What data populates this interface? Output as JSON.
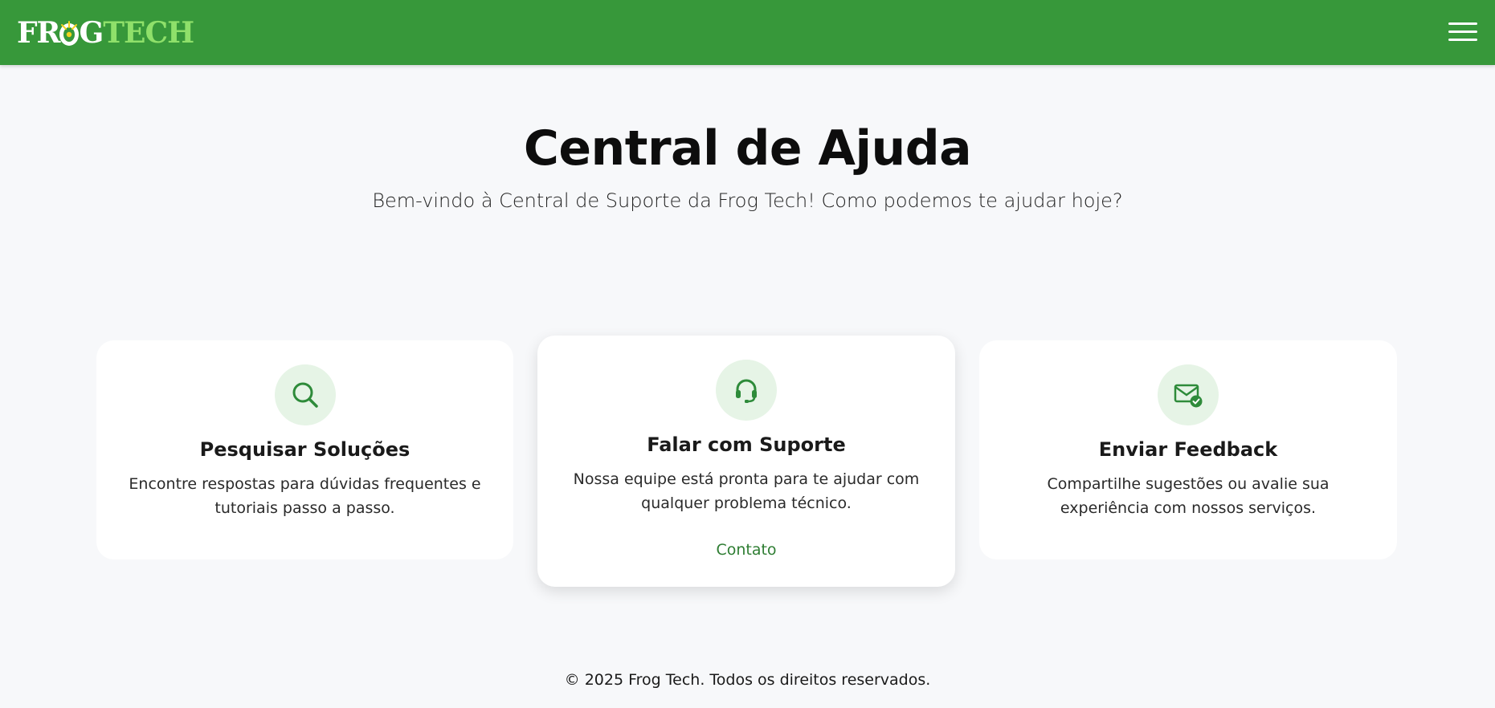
{
  "header": {
    "logo_part1": "FR",
    "logo_part2": "G",
    "logo_part3": "TECH",
    "brand_color": "#37983a",
    "logo_accent": "#8fe06a",
    "menu_icon": "hamburger-menu-icon"
  },
  "hero": {
    "title": "Central de Ajuda",
    "subtitle": "Bem-vindo à Central de Suporte da Frog Tech! Como podemos te ajudar hoje?"
  },
  "cards": [
    {
      "icon": "search-icon",
      "title": "Pesquisar Soluções",
      "description": "Encontre respostas para dúvidas frequentes e tutoriais passo a passo."
    },
    {
      "icon": "headset-icon",
      "title": "Falar com Suporte",
      "description": "Nossa equipe está pronta para te ajudar com qualquer problema técnico.",
      "link": "Contato"
    },
    {
      "icon": "mail-check-icon",
      "title": "Enviar Feedback",
      "description": "Compartilhe sugestões ou avalie sua experiência com nossos serviços."
    }
  ],
  "colors": {
    "icon_green": "#2e8b3a",
    "icon_bg": "#e6f4e6",
    "link": "#2e7d32",
    "page_bg": "#f7f8fa"
  },
  "footer": {
    "text": "© 2025 Frog Tech. Todos os direitos reservados."
  }
}
